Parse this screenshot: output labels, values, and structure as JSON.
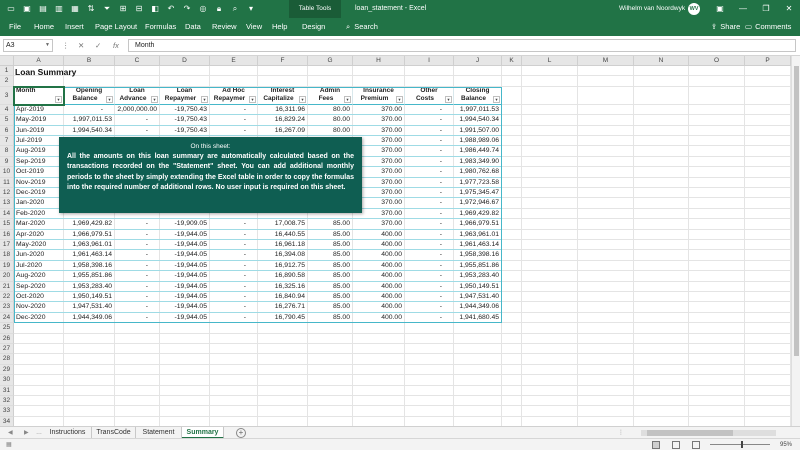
{
  "titlebar": {
    "table_tools": "Table Tools",
    "doc_title": "loan_statement  -  Excel",
    "user_name": "Wilhelm van Noordwyk",
    "avatar_initials": "WV"
  },
  "ribbon": {
    "tabs": [
      "File",
      "Home",
      "Insert",
      "Page Layout",
      "Formulas",
      "Data",
      "Review",
      "View",
      "Help",
      "Design"
    ],
    "search_label": "Search",
    "share_label": "Share",
    "comments_label": "Comments"
  },
  "formula_bar": {
    "name_box": "A3",
    "fx": "fx",
    "content": "Month"
  },
  "columns": [
    "A",
    "B",
    "C",
    "D",
    "E",
    "F",
    "G",
    "H",
    "I",
    "J",
    "K",
    "L",
    "M",
    "N",
    "O",
    "P"
  ],
  "rows": [
    "1",
    "2",
    "3",
    "4",
    "5",
    "6",
    "7",
    "8",
    "9",
    "10",
    "11",
    "12",
    "13",
    "14",
    "15",
    "16",
    "17",
    "18",
    "19",
    "20",
    "21",
    "22",
    "23",
    "24",
    "25",
    "26",
    "27",
    "28",
    "29",
    "30",
    "31",
    "32",
    "33",
    "34"
  ],
  "sheet_title": "Loan Summary",
  "table": {
    "headers": [
      [
        "",
        "Month"
      ],
      [
        "Opening",
        "Balance"
      ],
      [
        "Loan",
        "Advance"
      ],
      [
        "Loan",
        "Repaymer"
      ],
      [
        "Ad Hoc",
        "Repaymer"
      ],
      [
        "Interest",
        "Capitalize"
      ],
      [
        "Admin",
        "Fees"
      ],
      [
        "Insurance",
        "Premium"
      ],
      [
        "Other",
        "Costs"
      ],
      [
        "Closing",
        "Balance"
      ]
    ],
    "rows": [
      [
        "Apr-2019",
        "-",
        "2,000,000.00",
        "-19,750.43",
        "-",
        "16,311.96",
        "80.00",
        "370.00",
        "-",
        "1,997,011.53"
      ],
      [
        "May-2019",
        "1,997,011.53",
        "-",
        "-19,750.43",
        "-",
        "16,829.24",
        "80.00",
        "370.00",
        "-",
        "1,994,540.34"
      ],
      [
        "Jun-2019",
        "1,994,540.34",
        "-",
        "-19,750.43",
        "-",
        "16,267.09",
        "80.00",
        "370.00",
        "-",
        "1,991,507.00"
      ],
      [
        "Jul-2019",
        "",
        "",
        "",
        "",
        "",
        "",
        "370.00",
        "-",
        "1,988,989.06"
      ],
      [
        "Aug-2019",
        "",
        "",
        "",
        "",
        "",
        "",
        "370.00",
        "-",
        "1,986,449.74"
      ],
      [
        "Sep-2019",
        "",
        "",
        "",
        "",
        "",
        "",
        "370.00",
        "-",
        "1,983,349.90"
      ],
      [
        "Oct-2019",
        "",
        "",
        "",
        "",
        "",
        "",
        "370.00",
        "-",
        "1,980,762.68"
      ],
      [
        "Nov-2019",
        "",
        "",
        "",
        "",
        "",
        "",
        "370.00",
        "-",
        "1,977,723.58"
      ],
      [
        "Dec-2019",
        "",
        "",
        "",
        "",
        "",
        "",
        "370.00",
        "-",
        "1,975,345.47"
      ],
      [
        "Jan-2020",
        "",
        "",
        "",
        "",
        "",
        "",
        "370.00",
        "-",
        "1,972,946.67"
      ],
      [
        "Feb-2020",
        "",
        "",
        "",
        "",
        "",
        "",
        "370.00",
        "-",
        "1,969,429.82"
      ],
      [
        "Mar-2020",
        "1,969,429.82",
        "-",
        "-19,909.05",
        "-",
        "17,008.75",
        "85.00",
        "370.00",
        "-",
        "1,966,979.51"
      ],
      [
        "Apr-2020",
        "1,966,979.51",
        "-",
        "-19,944.05",
        "-",
        "16,440.55",
        "85.00",
        "400.00",
        "-",
        "1,963,961.01"
      ],
      [
        "May-2020",
        "1,963,961.01",
        "-",
        "-19,944.05",
        "-",
        "16,961.18",
        "85.00",
        "400.00",
        "-",
        "1,961,463.14"
      ],
      [
        "Jun-2020",
        "1,961,463.14",
        "-",
        "-19,944.05",
        "-",
        "16,394.08",
        "85.00",
        "400.00",
        "-",
        "1,958,398.16"
      ],
      [
        "Jul-2020",
        "1,958,398.16",
        "-",
        "-19,944.05",
        "-",
        "16,912.75",
        "85.00",
        "400.00",
        "-",
        "1,955,851.86"
      ],
      [
        "Aug-2020",
        "1,955,851.86",
        "-",
        "-19,944.05",
        "-",
        "16,890.58",
        "85.00",
        "400.00",
        "-",
        "1,953,283.40"
      ],
      [
        "Sep-2020",
        "1,953,283.40",
        "-",
        "-19,944.05",
        "-",
        "16,325.16",
        "85.00",
        "400.00",
        "-",
        "1,950,149.51"
      ],
      [
        "Oct-2020",
        "1,950,149.51",
        "-",
        "-19,944.05",
        "-",
        "16,840.94",
        "85.00",
        "400.00",
        "-",
        "1,947,531.40"
      ],
      [
        "Nov-2020",
        "1,947,531.40",
        "-",
        "-19,944.05",
        "-",
        "16,276.71",
        "85.00",
        "400.00",
        "-",
        "1,944,349.06"
      ],
      [
        "Dec-2020",
        "1,944,349.06",
        "-",
        "-19,944.05",
        "-",
        "16,790.45",
        "85.00",
        "400.00",
        "-",
        "1,941,680.45"
      ]
    ]
  },
  "popup": {
    "title": "On this sheet:",
    "body": "All the amounts on this loan summary are automatically calculated based on the transactions recorded on the \"Statement\" sheet. You can add additional monthly periods to the sheet by simply extending the Excel table in order to copy the formulas into the required number of additional rows. No user input is required on this sheet."
  },
  "sheet_tabs": [
    "Instructions",
    "TransCode",
    "Statement",
    "Summary"
  ],
  "active_sheet": "Summary",
  "status": {
    "zoom": "95%"
  },
  "colors": {
    "excel_green": "#217346",
    "popup_bg": "#0f5e52",
    "table_border": "#46b7c9"
  }
}
